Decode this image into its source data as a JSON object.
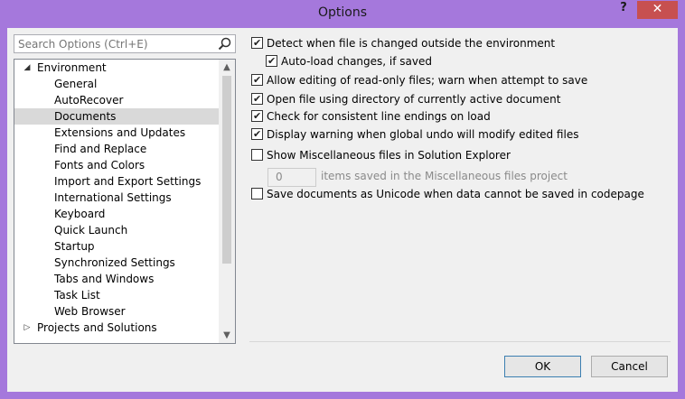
{
  "window": {
    "title": "Options",
    "help_label": "?",
    "close_label": "✕"
  },
  "search": {
    "placeholder": "Search Options (Ctrl+E)"
  },
  "tree": {
    "environment": {
      "label": "Environment",
      "expander": "◢"
    },
    "children": [
      "General",
      "AutoRecover",
      "Documents",
      "Extensions and Updates",
      "Find and Replace",
      "Fonts and Colors",
      "Import and Export Settings",
      "International Settings",
      "Keyboard",
      "Quick Launch",
      "Startup",
      "Synchronized Settings",
      "Tabs and Windows",
      "Task List",
      "Web Browser"
    ],
    "selected": "Documents",
    "projects": {
      "label": "Projects and Solutions",
      "expander": "▷"
    }
  },
  "options": {
    "detect_changes": {
      "label": "Detect when file is changed outside the environment",
      "checked": true
    },
    "auto_load": {
      "label": "Auto-load changes, if saved",
      "checked": true
    },
    "allow_readonly": {
      "label": "Allow editing of read-only files; warn when attempt to save",
      "checked": true
    },
    "open_dir": {
      "label": "Open file using directory of currently active document",
      "checked": true
    },
    "line_endings": {
      "label": "Check for consistent line endings on load",
      "checked": true
    },
    "undo_warning": {
      "label": "Display warning when global undo will modify edited files",
      "checked": true
    },
    "show_misc": {
      "label": "Show Miscellaneous files in Solution Explorer",
      "checked": false
    },
    "misc_count": "0",
    "misc_text": "items saved in the Miscellaneous files project",
    "unicode": {
      "label": "Save documents as Unicode when data cannot be saved in codepage",
      "checked": false
    }
  },
  "buttons": {
    "ok": "OK",
    "cancel": "Cancel"
  },
  "colors": {
    "accent_frame": "#a578dc",
    "close_button": "#c75050",
    "selected_item": "#d9d9d9"
  }
}
